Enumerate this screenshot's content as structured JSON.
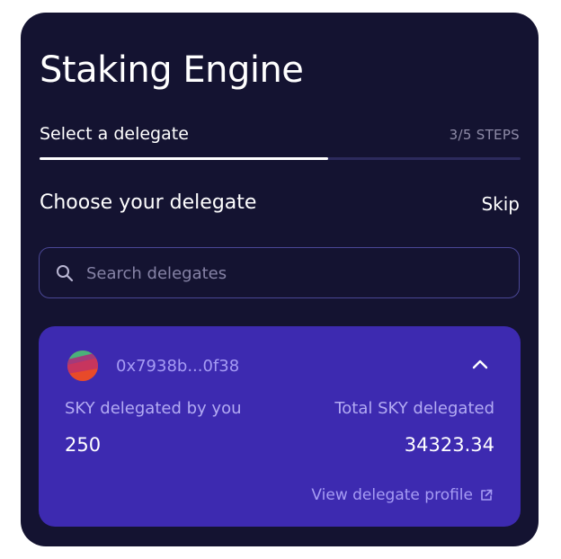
{
  "header": {
    "title": "Staking Engine"
  },
  "steps": {
    "label": "Select a delegate",
    "count": "3/5 STEPS",
    "progress_fraction": 0.6
  },
  "section": {
    "title": "Choose your delegate",
    "skip_label": "Skip"
  },
  "search": {
    "placeholder": "Search delegates",
    "value": "",
    "icon": "search-icon"
  },
  "delegate": {
    "address": "0x7938b...0f38",
    "delegated_by_you_label": "SKY delegated by you",
    "delegated_by_you_value": "250",
    "total_delegated_label": "Total SKY delegated",
    "total_delegated_value": "34323.34",
    "profile_link_label": "View delegate profile",
    "expanded": true
  },
  "colors": {
    "card_background": "#141331",
    "delegate_card": "#3d2ab0",
    "accent_text": "#a69cf4",
    "progress_track": "#2c2a5c"
  }
}
